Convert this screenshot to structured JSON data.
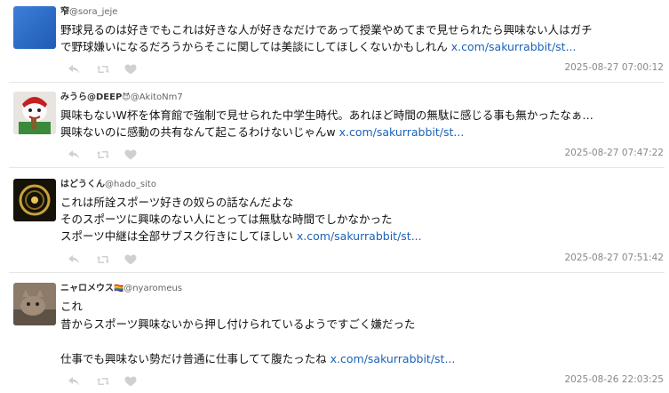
{
  "tweets": [
    {
      "name": "窄",
      "handle": "@sora_jeje",
      "lines": [
        "野球見るのは好きでもこれは好きな人が好きなだけであって授業やめてまで見せられたら興味ない人はガチ",
        "で野球嫌いになるだろうからそこに関しては美談にしてほしくないかもしれん"
      ],
      "link": "x.com/sakurrabbit/st...",
      "link_line": 1,
      "timestamp": "2025-08-27 07:00:12"
    },
    {
      "name": "みうら@DEEP",
      "badge": "😈",
      "handle": "@AkitoNm7",
      "lines": [
        "興味もないW杯を体育館で強制で見せられた中学生時代。あれほど時間の無駄に感じる事も無かったなぁ…",
        "興味ないのに感動の共有なんて起こるわけないじゃんw"
      ],
      "link": "x.com/sakurrabbit/st...",
      "link_line": 1,
      "timestamp": "2025-08-27 07:47:22"
    },
    {
      "name": "はどうくん",
      "handle": "@hado_sito",
      "lines": [
        "これは所詮スポーツ好きの奴らの話なんだよな",
        "そのスポーツに興味のない人にとっては無駄な時間でしかなかった",
        "スポーツ中継は全部サブスク行きにしてほしい"
      ],
      "link": "x.com/sakurrabbit/st...",
      "link_line": 2,
      "timestamp": "2025-08-27 07:51:42"
    },
    {
      "name": "ニャロメウス",
      "badge": "🏳️‍🌈",
      "handle": "@nyaromeus",
      "lines": [
        "これ",
        "昔からスポーツ興味ないから押し付けられているようですごく嫌だった",
        "",
        "仕事でも興味ない勢だけ普通に仕事してて腹たったね"
      ],
      "link": "x.com/sakurrabbit/st...",
      "link_line": 3,
      "timestamp": "2025-08-26 22:03:25"
    }
  ],
  "icons": {
    "reply": "reply-icon",
    "retweet": "retweet-icon",
    "like": "heart-icon"
  },
  "colors": {
    "link": "#1b62b8",
    "timestamp": "#888888",
    "icon": "#d0d0d0",
    "divider": "#e6e6e6"
  }
}
